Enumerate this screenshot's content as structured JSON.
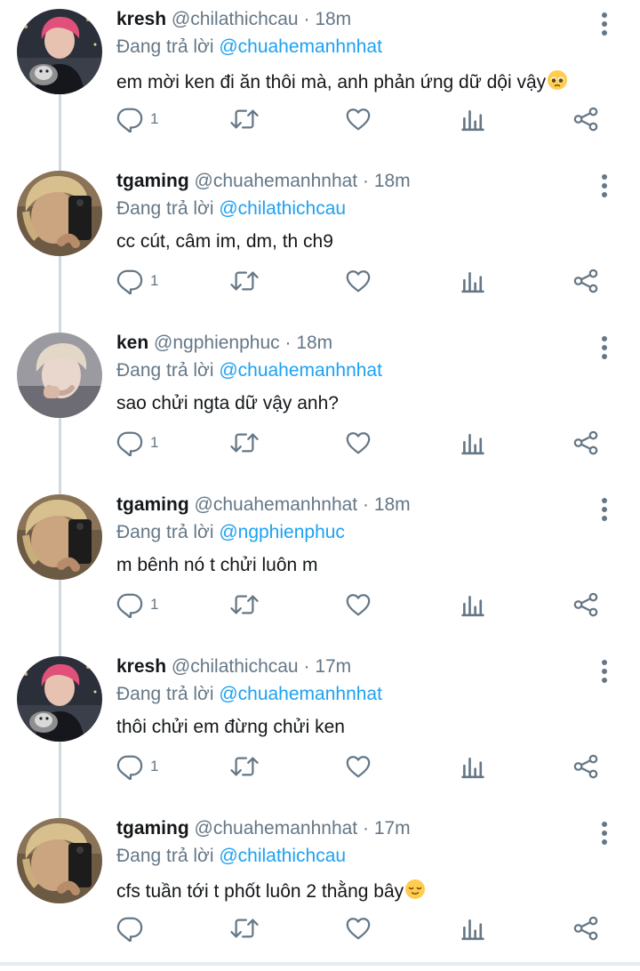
{
  "replying_label": "Đang trả lời",
  "colors": {
    "name": "#14171a",
    "muted": "#657786",
    "link": "#1da1f2",
    "thread_line": "#cfd9de"
  },
  "tweets": [
    {
      "name": "kresh",
      "handle": "@chilathichcau",
      "sep": "·",
      "time": "18m",
      "reply_to": "@chuahemanhnhat",
      "text": "em mời ken đi ăn thôi mà, anh phản ứng dữ dội vậy",
      "emoji": "pleading-face",
      "reply_count": "1",
      "avatar": "pink-hair-avatar"
    },
    {
      "name": "tgaming",
      "handle": "@chuahemanhnhat",
      "sep": "·",
      "time": "18m",
      "reply_to": "@chilathichcau",
      "text": "cc cút, câm im, dm, th ch9",
      "emoji": "",
      "reply_count": "1",
      "avatar": "blond-hair-avatar"
    },
    {
      "name": "ken",
      "handle": "@ngphienphuc",
      "sep": "·",
      "time": "18m",
      "reply_to": "@chuahemanhnhat",
      "text": "sao chửi ngta dữ vậy anh?",
      "emoji": "",
      "reply_count": "1",
      "avatar": "light-hair-avatar"
    },
    {
      "name": "tgaming",
      "handle": "@chuahemanhnhat",
      "sep": "·",
      "time": "18m",
      "reply_to": "@ngphienphuc",
      "text": "m bênh nó t chửi luôn m",
      "emoji": "",
      "reply_count": "1",
      "avatar": "blond-hair-avatar"
    },
    {
      "name": "kresh",
      "handle": "@chilathichcau",
      "sep": "·",
      "time": "17m",
      "reply_to": "@chuahemanhnhat",
      "text": "thôi chửi em đừng chửi ken",
      "emoji": "",
      "reply_count": "1",
      "avatar": "pink-hair-avatar"
    },
    {
      "name": "tgaming",
      "handle": "@chuahemanhnhat",
      "sep": "·",
      "time": "17m",
      "reply_to": "@chilathichcau",
      "text": "cfs tuần tới t phốt luôn 2 thằng bây",
      "emoji": "relieved-face",
      "reply_count": "",
      "avatar": "blond-hair-avatar"
    }
  ],
  "icons": {
    "reply": "reply-icon",
    "retweet": "retweet-icon",
    "like": "heart-icon",
    "stats": "bar-chart-icon",
    "share": "share-icon",
    "more": "more-vertical-icon"
  }
}
